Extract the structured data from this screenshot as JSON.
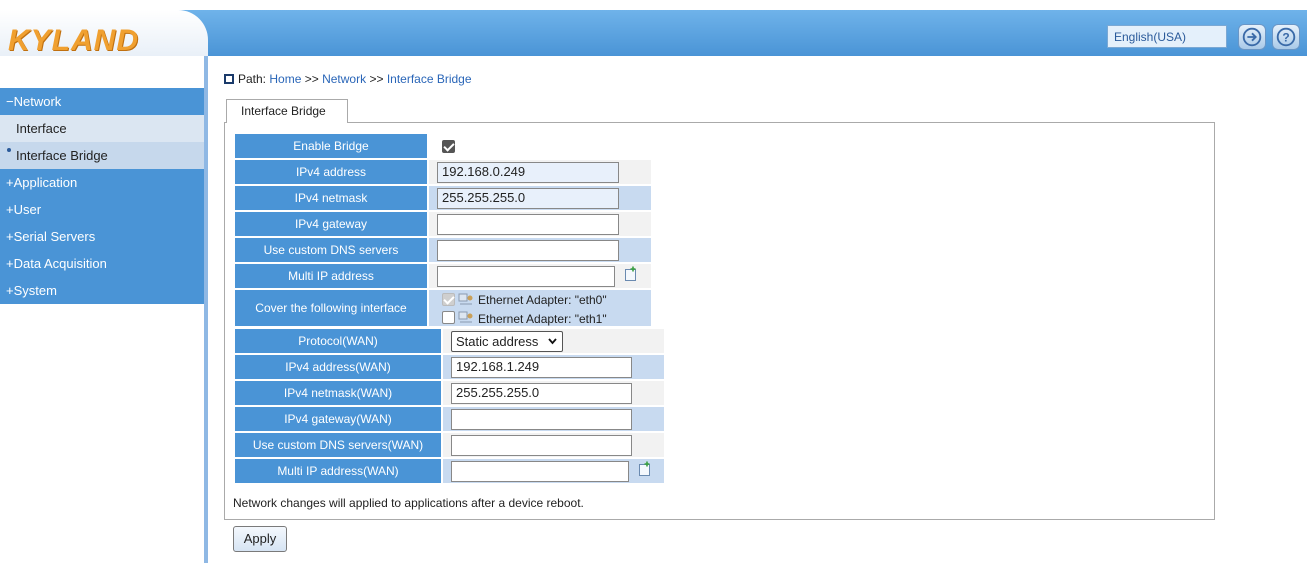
{
  "header": {
    "logo": "KYLAND",
    "language": "English(USA)",
    "icons": [
      "logout-icon",
      "help-icon"
    ]
  },
  "sidebar": {
    "items": [
      {
        "label": "−Network",
        "type": "group"
      },
      {
        "label": "Interface",
        "type": "sub"
      },
      {
        "label": "Interface Bridge",
        "type": "sub-active"
      },
      {
        "label": "+Application",
        "type": "group"
      },
      {
        "label": "+User",
        "type": "group"
      },
      {
        "label": "+Serial Servers",
        "type": "group"
      },
      {
        "label": "+Data Acquisition",
        "type": "group"
      },
      {
        "label": "+System",
        "type": "group"
      }
    ]
  },
  "breadcrumb": {
    "prefix": "Path:",
    "home": "Home",
    "sep1": ">>",
    "network": "Network",
    "sep2": ">>",
    "current": "Interface Bridge"
  },
  "tab": {
    "label": "Interface Bridge"
  },
  "form": {
    "enable_bridge": {
      "label": "Enable Bridge",
      "checked": true
    },
    "ipv4_address": {
      "label": "IPv4 address",
      "value": "192.168.0.249"
    },
    "ipv4_netmask": {
      "label": "IPv4 netmask",
      "value": "255.255.255.0"
    },
    "ipv4_gateway": {
      "label": "IPv4 gateway",
      "value": ""
    },
    "custom_dns": {
      "label": "Use custom DNS servers",
      "value": ""
    },
    "multi_ip": {
      "label": "Multi IP address",
      "value": ""
    },
    "cover_interface": {
      "label": "Cover the following interface",
      "options": [
        {
          "label": "Ethernet Adapter: \"eth0\"",
          "checked": true,
          "disabled": true
        },
        {
          "label": "Ethernet Adapter: \"eth1\"",
          "checked": false,
          "disabled": false
        }
      ]
    },
    "protocol_wan": {
      "label": "Protocol(WAN)",
      "value": "Static address"
    },
    "ipv4_address_wan": {
      "label": "IPv4 address(WAN)",
      "value": "192.168.1.249"
    },
    "ipv4_netmask_wan": {
      "label": "IPv4 netmask(WAN)",
      "value": "255.255.255.0"
    },
    "ipv4_gateway_wan": {
      "label": "IPv4 gateway(WAN)",
      "value": ""
    },
    "custom_dns_wan": {
      "label": "Use custom DNS servers(WAN)",
      "value": ""
    },
    "multi_ip_wan": {
      "label": "Multi IP address(WAN)",
      "value": ""
    }
  },
  "note": "Network changes will applied to applications after a device reboot.",
  "apply_label": "Apply"
}
